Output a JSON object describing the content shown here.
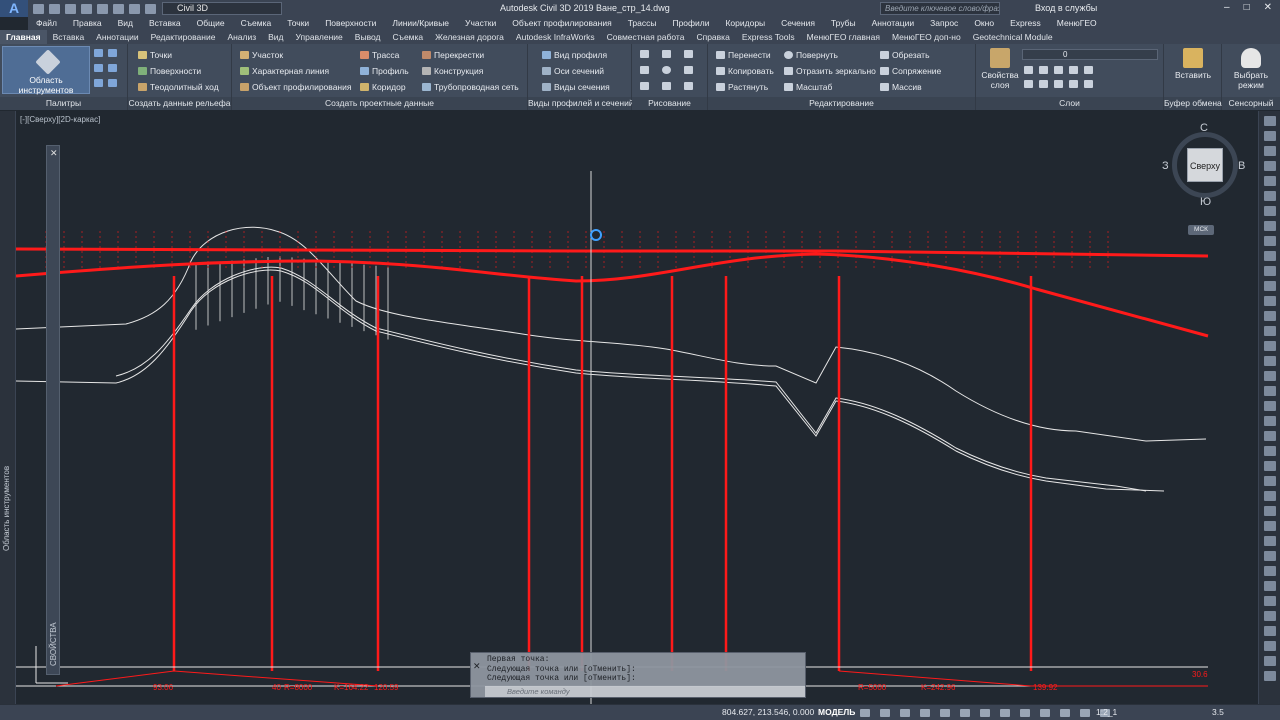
{
  "titlebar": {
    "logo": "A",
    "workspace": "Civil 3D",
    "app_title": "Autodesk Civil 3D 2019   Ване_стр_14.dwg",
    "search_placeholder": "Введите ключевое слово/фразу",
    "signin": "Вход в службы"
  },
  "menubar": [
    "Файл",
    "Правка",
    "Вид",
    "Вставка",
    "Общие",
    "Съемка",
    "Точки",
    "Поверхности",
    "Линии/Кривые",
    "Участки",
    "Объект профилирования",
    "Трассы",
    "Профили",
    "Коридоры",
    "Сечения",
    "Трубы",
    "Аннотации",
    "Запрос",
    "Окно",
    "Express",
    "МенюГЕО"
  ],
  "tabs": [
    "Главная",
    "Вставка",
    "Аннотации",
    "Редактирование",
    "Анализ",
    "Вид",
    "Управление",
    "Вывод",
    "Съемка",
    "Железная дорога",
    "Autodesk InfraWorks",
    "Совместная работа",
    "Справка",
    "Express Tools",
    "МенюГЕО главная",
    "МенюГЕО доп-но",
    "Geotechnical Module"
  ],
  "active_tab": "Главная",
  "ribbon": {
    "palettes_button": "Область инструментов",
    "group_labels": {
      "palettes": "Палитры",
      "ground": "Создать данные рельефа",
      "design": "Создать проектные данные",
      "views": "Виды профилей и сечений",
      "draw": "Рисование",
      "modify": "Редактирование",
      "layers": "Слои",
      "clipboard": "Буфер обмена",
      "touch": "Сенсорный"
    },
    "ground_items": [
      "Точки",
      "Поверхности",
      "Теодолитный ход"
    ],
    "design_col1": [
      "Участок",
      "Характерная линия",
      "Объект профилирования"
    ],
    "design_col2": [
      "Трасса",
      "Профиль",
      "Коридор"
    ],
    "design_col3": [
      "Перекрестки",
      "Конструкция",
      "Трубопроводная сеть"
    ],
    "views_items": [
      "Вид профиля",
      "Оси сечений",
      "Виды сечения"
    ],
    "modify_col1": [
      "Перенести",
      "Копировать",
      "Растянуть"
    ],
    "modify_col2": [
      "Повернуть",
      "Отразить зеркально",
      "Масштаб"
    ],
    "modify_col3": [
      "Обрезать",
      "Сопряжение",
      "Массив"
    ],
    "layer_props": "Свойства слоя",
    "layer_value": "0",
    "paste": "Вставить",
    "select_mode": "Выбрать режим"
  },
  "canvas": {
    "view_label": "[-][Сверху][2D-каркас]",
    "stations": [
      "93.06",
      "40",
      "R=8000",
      "K=164.22",
      "120.59",
      "R=5000",
      "K=242.96",
      "139.92",
      "30.6"
    ]
  },
  "viewcube": {
    "face": "Сверху",
    "north": "С",
    "south": "Ю",
    "east": "В",
    "west": "З",
    "wcs": "МСК"
  },
  "left_palette_label": "Область инструментов",
  "props_palette_label": "СВОЙСТВА",
  "command": {
    "history": [
      "Первая точка:",
      "Следующая точка или [оТменить]:",
      "Следующая точка или [оТменить]:"
    ],
    "input_placeholder": "Введите команду"
  },
  "statusbar": {
    "coords": "804.627, 213.546, 0.000",
    "model": "МОДЕЛЬ",
    "scale": "1:2_1",
    "zoom": "3.5"
  },
  "colors": {
    "accent_red": "#ff1a1a",
    "drawing_bg": "#212830",
    "ribbon_bg": "#414c5c"
  }
}
